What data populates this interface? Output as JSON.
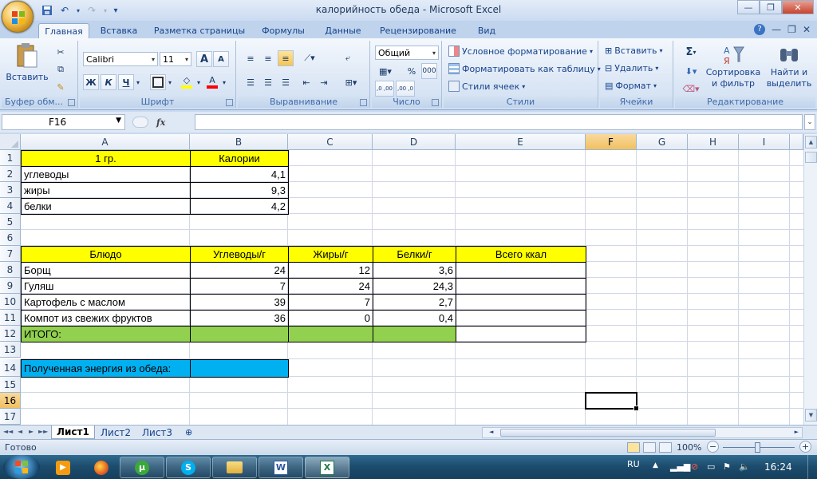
{
  "window": {
    "title": "калорийность обеда - Microsoft Excel",
    "qat_dropdown": "▾",
    "controls": {
      "minimize": "—",
      "restore": "❐",
      "close": "✕"
    },
    "ribbon_controls": {
      "minimize": "—",
      "restore": "❐",
      "close": "✕"
    },
    "help": "?"
  },
  "tabs": [
    "Главная",
    "Вставка",
    "Разметка страницы",
    "Формулы",
    "Данные",
    "Рецензирование",
    "Вид"
  ],
  "ribbon": {
    "clipboard": {
      "label": "Буфер обм...",
      "paste": "Вставить"
    },
    "font": {
      "label": "Шрифт",
      "font_name": "Calibri",
      "font_size": "11",
      "bold": "Ж",
      "italic": "К",
      "underline": "Ч",
      "grow": "A",
      "shrink": "A",
      "font_color_letter": "A",
      "accent": "#ff0000",
      "fill_accent": "#ffff00"
    },
    "alignment": {
      "label": "Выравнивание"
    },
    "number": {
      "label": "Число",
      "format": "Общий",
      "percent": "%",
      "thousands": "000",
      "inc_dec": ",0 ,00",
      "dec_dec": ",00 ,0"
    },
    "styles": {
      "label": "Стили",
      "conditional": "Условное форматирование",
      "as_table": "Форматировать как таблицу",
      "cell_styles": "Стили ячеек"
    },
    "cells": {
      "label": "Ячейки",
      "insert": "Вставить",
      "delete": "Удалить",
      "format": "Формат"
    },
    "editing": {
      "label": "Редактирование",
      "sum": "Σ",
      "sort_line1": "Сортировка",
      "sort_line2": "и фильтр",
      "find_line1": "Найти и",
      "find_line2": "выделить"
    }
  },
  "formula_bar": {
    "name_box": "F16",
    "fx": "fx",
    "value": ""
  },
  "columns": [
    "A",
    "B",
    "C",
    "D",
    "E",
    "F",
    "G",
    "H",
    "I"
  ],
  "rows": [
    "1",
    "2",
    "3",
    "4",
    "5",
    "6",
    "7",
    "8",
    "9",
    "10",
    "11",
    "12",
    "13",
    "14",
    "15",
    "16",
    "17"
  ],
  "selected_cell": {
    "column": "F",
    "row": "16"
  },
  "calorie_table": {
    "headers": [
      "1 гр.",
      "Калории"
    ],
    "rows": [
      [
        "углеводы",
        "4,1"
      ],
      [
        "жиры",
        "9,3"
      ],
      [
        "белки",
        "4,2"
      ]
    ]
  },
  "meal_table": {
    "headers": [
      "Блюдо",
      "Углеводы/г",
      "Жиры/г",
      "Белки/г",
      "Всего ккал"
    ],
    "rows": [
      [
        "Борщ",
        "24",
        "12",
        "3,6",
        ""
      ],
      [
        "Гуляш",
        "7",
        "24",
        "24,3",
        ""
      ],
      [
        "Картофель с маслом",
        "39",
        "7",
        "2,7",
        ""
      ],
      [
        "Компот из свежих фруктов",
        "36",
        "0",
        "0,4",
        ""
      ]
    ],
    "total_label": "ИТОГО:"
  },
  "energy_label": "Полученная энергия из обеда:",
  "colors": {
    "header_yellow": "#ffff00",
    "total_green": "#92d050",
    "energy_blue": "#00b0f0"
  },
  "sheets": [
    "Лист1",
    "Лист2",
    "Лист3"
  ],
  "sheet_nav": [
    "◄◄",
    "◄",
    "►",
    "►►"
  ],
  "status": {
    "ready": "Готово",
    "zoom": "100%",
    "zoom_minus": "−",
    "zoom_plus": "+"
  },
  "taskbar": {
    "lang": "RU",
    "time": "16:24"
  }
}
